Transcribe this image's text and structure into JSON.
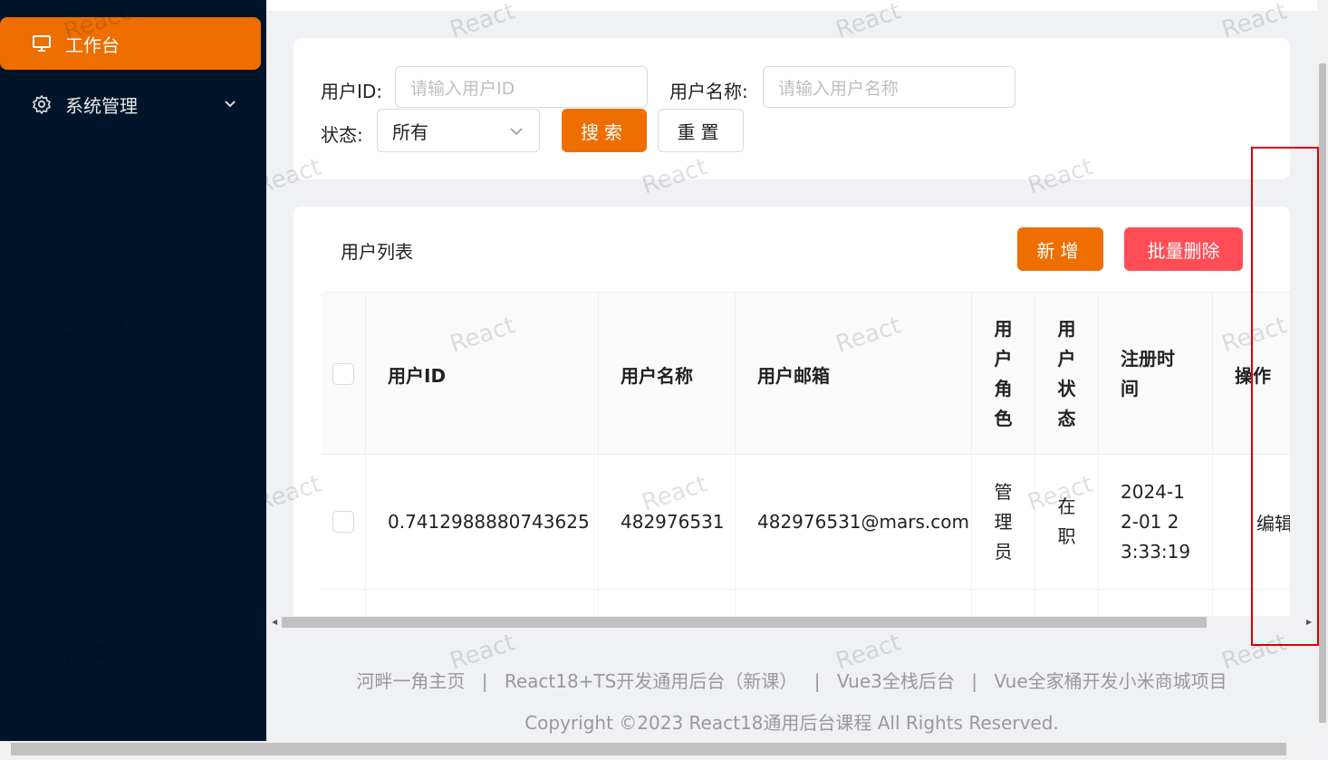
{
  "sidebar": {
    "items": [
      {
        "label": "工作台",
        "icon": "desktop-icon",
        "active": true
      },
      {
        "label": "系统管理",
        "icon": "gear-icon",
        "active": false
      }
    ]
  },
  "search": {
    "user_id_label": "用户ID:",
    "user_id_placeholder": "请输入用户ID",
    "user_name_label": "用户名称:",
    "user_name_placeholder": "请输入用户名称",
    "status_label": "状态:",
    "status_value": "所有",
    "search_button": "搜索",
    "reset_button": "重置"
  },
  "list": {
    "title": "用户列表",
    "add_button": "新增",
    "batch_delete_button": "批量删除",
    "columns": [
      "用户ID",
      "用户名称",
      "用户邮箱",
      "用户角色",
      "用户状态",
      "注册时间",
      "操作"
    ],
    "rows": [
      {
        "user_id": "0.7412988880743625",
        "user_name": "482976531",
        "email": "482976531@mars.com",
        "role": "管理员",
        "status": "在职",
        "register_time": "2024-12-01 23:33:19",
        "action": "编辑"
      }
    ]
  },
  "footer": {
    "links": [
      "河畔一角主页",
      "React18+TS开发通用后台（新课）",
      "Vue3全栈后台",
      "Vue全家桶开发小米商城项目"
    ],
    "separator": "|",
    "copyright": "Copyright ©2023 React18通用后台课程 All Rights Reserved."
  },
  "watermark_text": "React",
  "colors": {
    "sidebar_bg": "#001529",
    "accent": "#ee6e00",
    "danger": "#ff4d55",
    "page_bg": "#f0f1f4"
  }
}
